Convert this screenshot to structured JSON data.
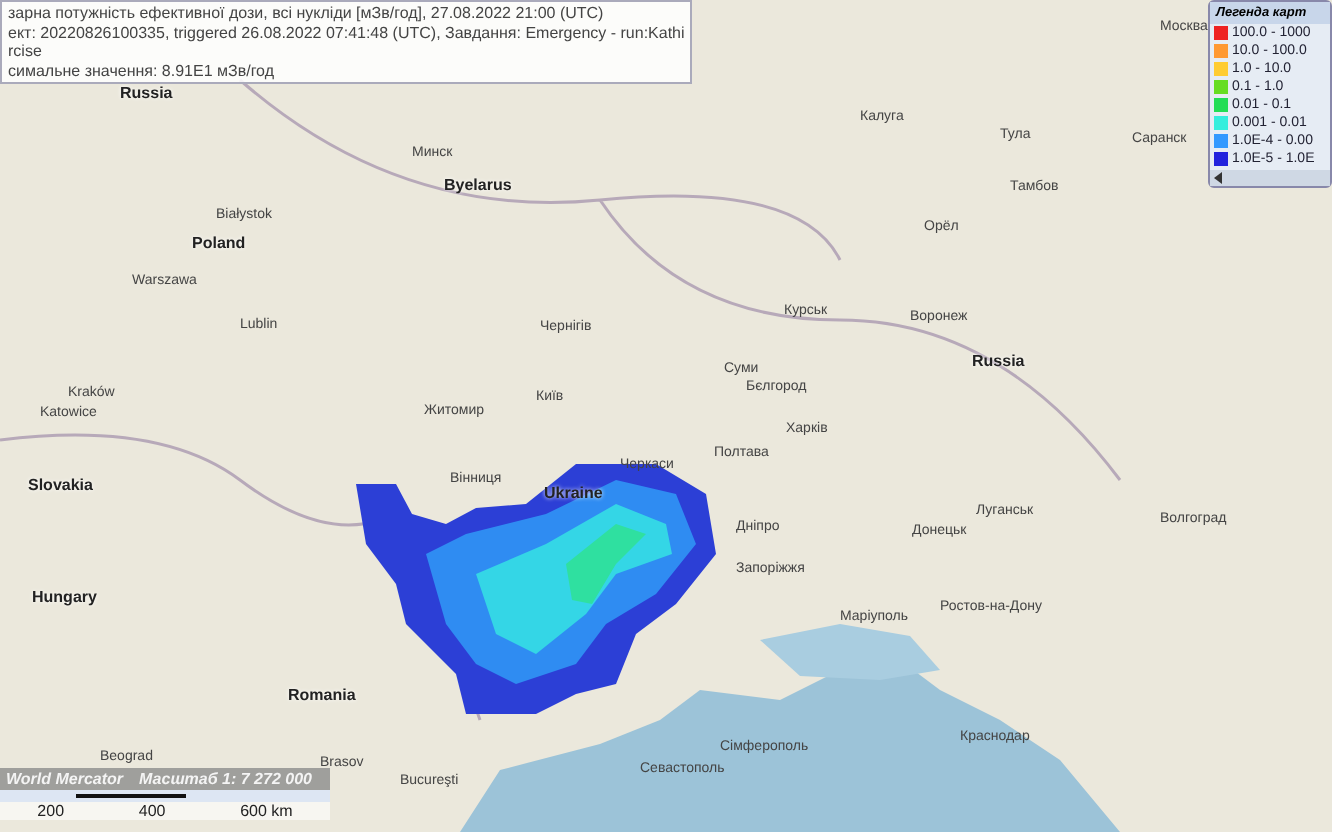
{
  "info": {
    "lines": [
      "зарна потужність ефективної дози, всі нукліди [мЗв/год], 27.08.2022 21:00 (UTC)",
      "ект: 20220826100335, triggered 26.08.2022 07:41:48 (UTC), Завдання: Emergency - run:Kathi",
      "rcise",
      "симальне значення: 8.91E1 мЗв/год"
    ]
  },
  "legend": {
    "title": "Легенда карт",
    "items": [
      {
        "label": "100.0 - 1000",
        "color": "#ee2222"
      },
      {
        "label": "10.0 - 100.0",
        "color": "#ff9933"
      },
      {
        "label": "1.0 - 10.0",
        "color": "#ffcc33"
      },
      {
        "label": "0.1 - 1.0",
        "color": "#66dd22"
      },
      {
        "label": "0.01 - 0.1",
        "color": "#22dd55"
      },
      {
        "label": "0.001 - 0.01",
        "color": "#33eedd"
      },
      {
        "label": "1.0E-4 - 0.00",
        "color": "#3399ff"
      },
      {
        "label": "1.0E-5 - 1.0E",
        "color": "#2222dd"
      }
    ]
  },
  "places": [
    {
      "name": "Москва",
      "kind": "city"
    },
    {
      "name": "Russia",
      "kind": "country"
    },
    {
      "name": "Калуга",
      "kind": "city"
    },
    {
      "name": "Тула",
      "kind": "city"
    },
    {
      "name": "Саранск",
      "kind": "city"
    },
    {
      "name": "Минск",
      "kind": "city"
    },
    {
      "name": "Byelarus",
      "kind": "country"
    },
    {
      "name": "Тамбов",
      "kind": "city"
    },
    {
      "name": "Białystok",
      "kind": "city"
    },
    {
      "name": "Орёл",
      "kind": "city"
    },
    {
      "name": "Poland",
      "kind": "country"
    },
    {
      "name": "Warszawa",
      "kind": "city"
    },
    {
      "name": "Курськ",
      "kind": "city"
    },
    {
      "name": "Воронеж",
      "kind": "city"
    },
    {
      "name": "Lublin",
      "kind": "city"
    },
    {
      "name": "Чернігів",
      "kind": "city"
    },
    {
      "name": "Russia",
      "kind": "country"
    },
    {
      "name": "Суми",
      "kind": "city"
    },
    {
      "name": "Бєлгород",
      "kind": "city"
    },
    {
      "name": "Kraków",
      "kind": "city"
    },
    {
      "name": "Київ",
      "kind": "city"
    },
    {
      "name": "Житомир",
      "kind": "city"
    },
    {
      "name": "Katowice",
      "kind": "city"
    },
    {
      "name": "Харків",
      "kind": "city"
    },
    {
      "name": "Полтава",
      "kind": "city"
    },
    {
      "name": "Черкаси",
      "kind": "city"
    },
    {
      "name": "Вінниця",
      "kind": "city"
    },
    {
      "name": "Slovakia",
      "kind": "country"
    },
    {
      "name": "Ukraine",
      "kind": "country"
    },
    {
      "name": "Луганськ",
      "kind": "city"
    },
    {
      "name": "Волгоград",
      "kind": "city"
    },
    {
      "name": "Дніпро",
      "kind": "city"
    },
    {
      "name": "Донецьк",
      "kind": "city"
    },
    {
      "name": "Запоріжжя",
      "kind": "city"
    },
    {
      "name": "Hungary",
      "kind": "country"
    },
    {
      "name": "Ростов-на-Дону",
      "kind": "city"
    },
    {
      "name": "Маріуполь",
      "kind": "city"
    },
    {
      "name": "Romania",
      "kind": "country"
    },
    {
      "name": "Краснодар",
      "kind": "city"
    },
    {
      "name": "Сімферополь",
      "kind": "city"
    },
    {
      "name": "Beograd",
      "kind": "city"
    },
    {
      "name": "Brasov",
      "kind": "city"
    },
    {
      "name": "Севастополь",
      "kind": "city"
    },
    {
      "name": "Bucureşti",
      "kind": "city"
    }
  ],
  "scale": {
    "projection": "World Mercator",
    "ratio": "Масштаб 1: 7 272 000",
    "ticks": [
      "200",
      "400",
      "600 km"
    ]
  }
}
